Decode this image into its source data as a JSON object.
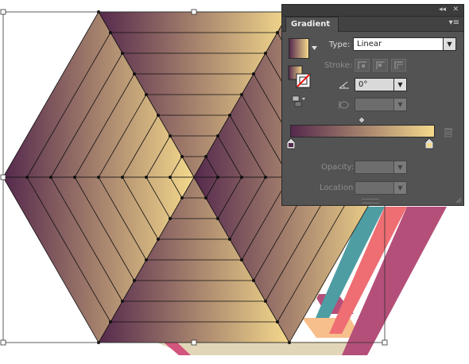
{
  "panel": {
    "tab_label": "Gradient",
    "collapse_glyph": "◂◂",
    "close_glyph": "✕",
    "menu_glyph": "▾≡",
    "type_label": "Type:",
    "type_value": "Linear",
    "stroke_label": "Stroke:",
    "angle_value": "0°",
    "opacity_label": "Opacity:",
    "location_label": "Location:",
    "trash_icon": "trash-icon",
    "angle_icon": "angle-icon",
    "aspect_icon": "aspect-ratio-icon"
  },
  "colors": {
    "gradient_start": "#55294d",
    "gradient_end": "#f4d98c",
    "panel_bg": "#535353",
    "stripe_cream": "#e2d6b8",
    "stripe_peach": "#f7bf8b",
    "stripe_teal": "#4e9da3",
    "stripe_coral": "#ee6e73",
    "stripe_plum": "#b44f79",
    "stripe_pink": "#d2557d"
  }
}
